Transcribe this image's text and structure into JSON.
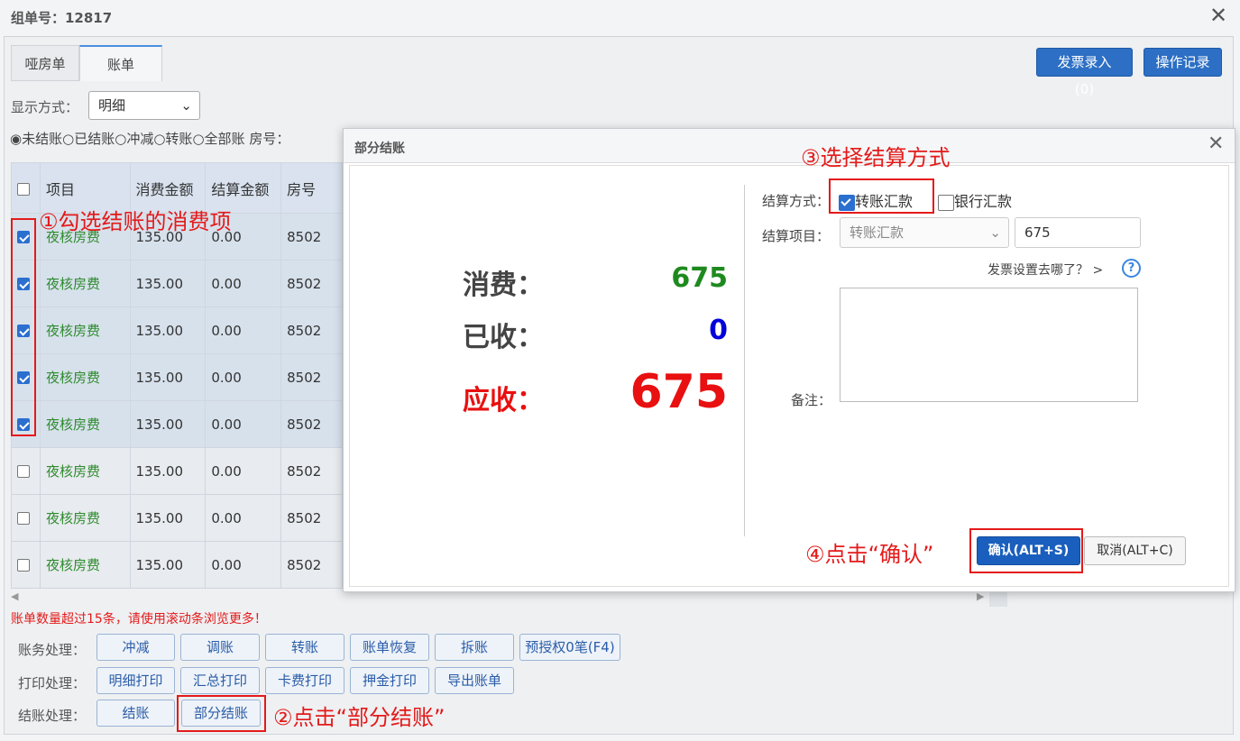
{
  "window": {
    "title": "组单号：12817"
  },
  "tabs": [
    {
      "label": "哑房单"
    },
    {
      "label": "账单"
    }
  ],
  "header_buttons": {
    "invoice": "发票录入(0)",
    "log": "操作记录"
  },
  "display": {
    "label": "显示方式：",
    "value": "明细"
  },
  "filters": {
    "unsettled": "未结账",
    "settled": "已结账",
    "offset": "冲减",
    "transfer": "转账",
    "all": "全部账",
    "room_label": "房号："
  },
  "table": {
    "headers": [
      "项目",
      "消费金额",
      "结算金额",
      "房号"
    ],
    "rows": [
      {
        "checked": true,
        "item": "夜核房费",
        "amount": "135.00",
        "settled": "0.00",
        "room": "8502"
      },
      {
        "checked": true,
        "item": "夜核房费",
        "amount": "135.00",
        "settled": "0.00",
        "room": "8502"
      },
      {
        "checked": true,
        "item": "夜核房费",
        "amount": "135.00",
        "settled": "0.00",
        "room": "8502"
      },
      {
        "checked": true,
        "item": "夜核房费",
        "amount": "135.00",
        "settled": "0.00",
        "room": "8502"
      },
      {
        "checked": true,
        "item": "夜核房费",
        "amount": "135.00",
        "settled": "0.00",
        "room": "8502"
      },
      {
        "checked": false,
        "item": "夜核房费",
        "amount": "135.00",
        "settled": "0.00",
        "room": "8502"
      },
      {
        "checked": false,
        "item": "夜核房费",
        "amount": "135.00",
        "settled": "0.00",
        "room": "8502"
      },
      {
        "checked": false,
        "item": "夜核房费",
        "amount": "135.00",
        "settled": "0.00",
        "room": "8502"
      }
    ]
  },
  "warning": "账单数量超过15条，请使用滚动条浏览更多！",
  "actions": {
    "accounting_label": "账务处理：",
    "accounting": [
      "冲减",
      "调账",
      "转账",
      "账单恢复",
      "拆账",
      "预授权0笔(F4)"
    ],
    "print_label": "打印处理：",
    "print": [
      "明细打印",
      "汇总打印",
      "卡费打印",
      "押金打印",
      "导出账单"
    ],
    "checkout_label": "结账处理：",
    "checkout": [
      "结账",
      "部分结账"
    ]
  },
  "annotations": {
    "step1": "①勾选结账的消费项",
    "step2": "②点击“部分结账”",
    "step3": "③选择结算方式",
    "step4": "④点击“确认”"
  },
  "dialog": {
    "title": "部分结账",
    "consume_label": "消费：",
    "consume_value": "675",
    "received_label": "已收：",
    "received_value": "0",
    "due_label": "应收：",
    "due_value": "675",
    "method_label": "结算方式：",
    "method_transfer": "转账汇款",
    "method_transfer_checked": true,
    "method_bank": "银行汇款",
    "method_bank_checked": false,
    "item_label": "结算项目：",
    "item_value": "转账汇款",
    "item_amount": "675",
    "invoice_link": "发票设置去哪了？ >",
    "remark_label": "备注：",
    "confirm": "确认(ALT+S)",
    "cancel": "取消(ALT+C)"
  },
  "colors": {
    "consume": "#1e8a1e",
    "received": "#0000dd",
    "due": "#e81010",
    "annotation": "#e41a1a",
    "primary": "#2c6fc4"
  }
}
